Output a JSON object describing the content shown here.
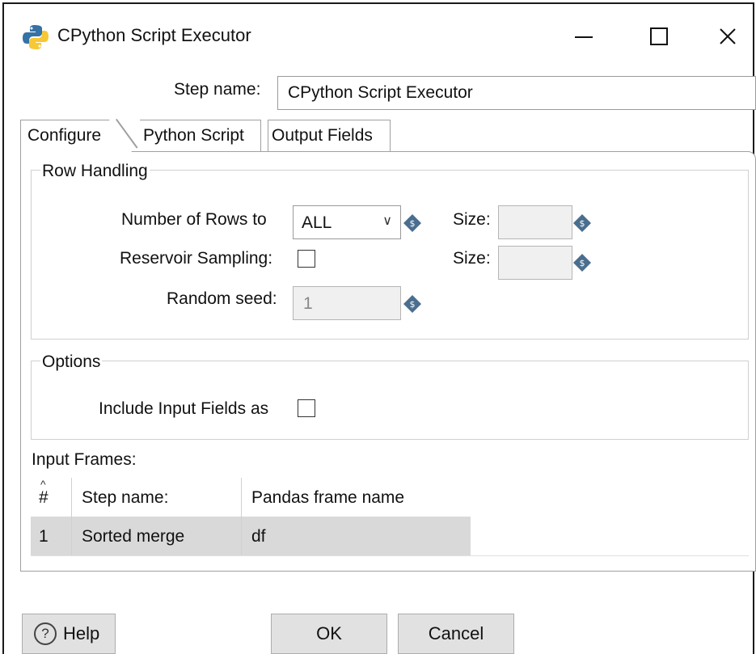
{
  "window": {
    "title": "CPython Script Executor",
    "icon": "python-logo-icon",
    "controls": {
      "minimize": "—",
      "maximize": "☐",
      "close": "✕"
    }
  },
  "step": {
    "label": "Step name:",
    "value": "CPython Script Executor"
  },
  "tabs": [
    {
      "label": "Configure",
      "active": true
    },
    {
      "label": "Python Script",
      "active": false
    },
    {
      "label": "Output Fields",
      "active": false
    }
  ],
  "row_handling": {
    "legend": "Row Handling",
    "rows_label": "Number of Rows to",
    "rows_value": "ALL",
    "size_label_1": "Size:",
    "size_value_1": "",
    "reservoir_label": "Reservoir Sampling:",
    "reservoir_checked": false,
    "size_label_2": "Size:",
    "size_value_2": "",
    "seed_label": "Random seed:",
    "seed_value": "1"
  },
  "options": {
    "legend": "Options",
    "include_label": "Include Input Fields as",
    "include_checked": false
  },
  "input_frames": {
    "label": "Input Frames:",
    "columns": [
      "#",
      "Step name:",
      "Pandas frame name"
    ],
    "rows": [
      {
        "num": "1",
        "step": "Sorted merge",
        "frame": "df"
      }
    ]
  },
  "buttons": {
    "help": "Help",
    "ok": "OK",
    "cancel": "Cancel"
  },
  "colors": {
    "variable_icon": "#4a6e8e",
    "button_bg": "#e1e1e1",
    "selected_row": "#d9d9d9"
  }
}
